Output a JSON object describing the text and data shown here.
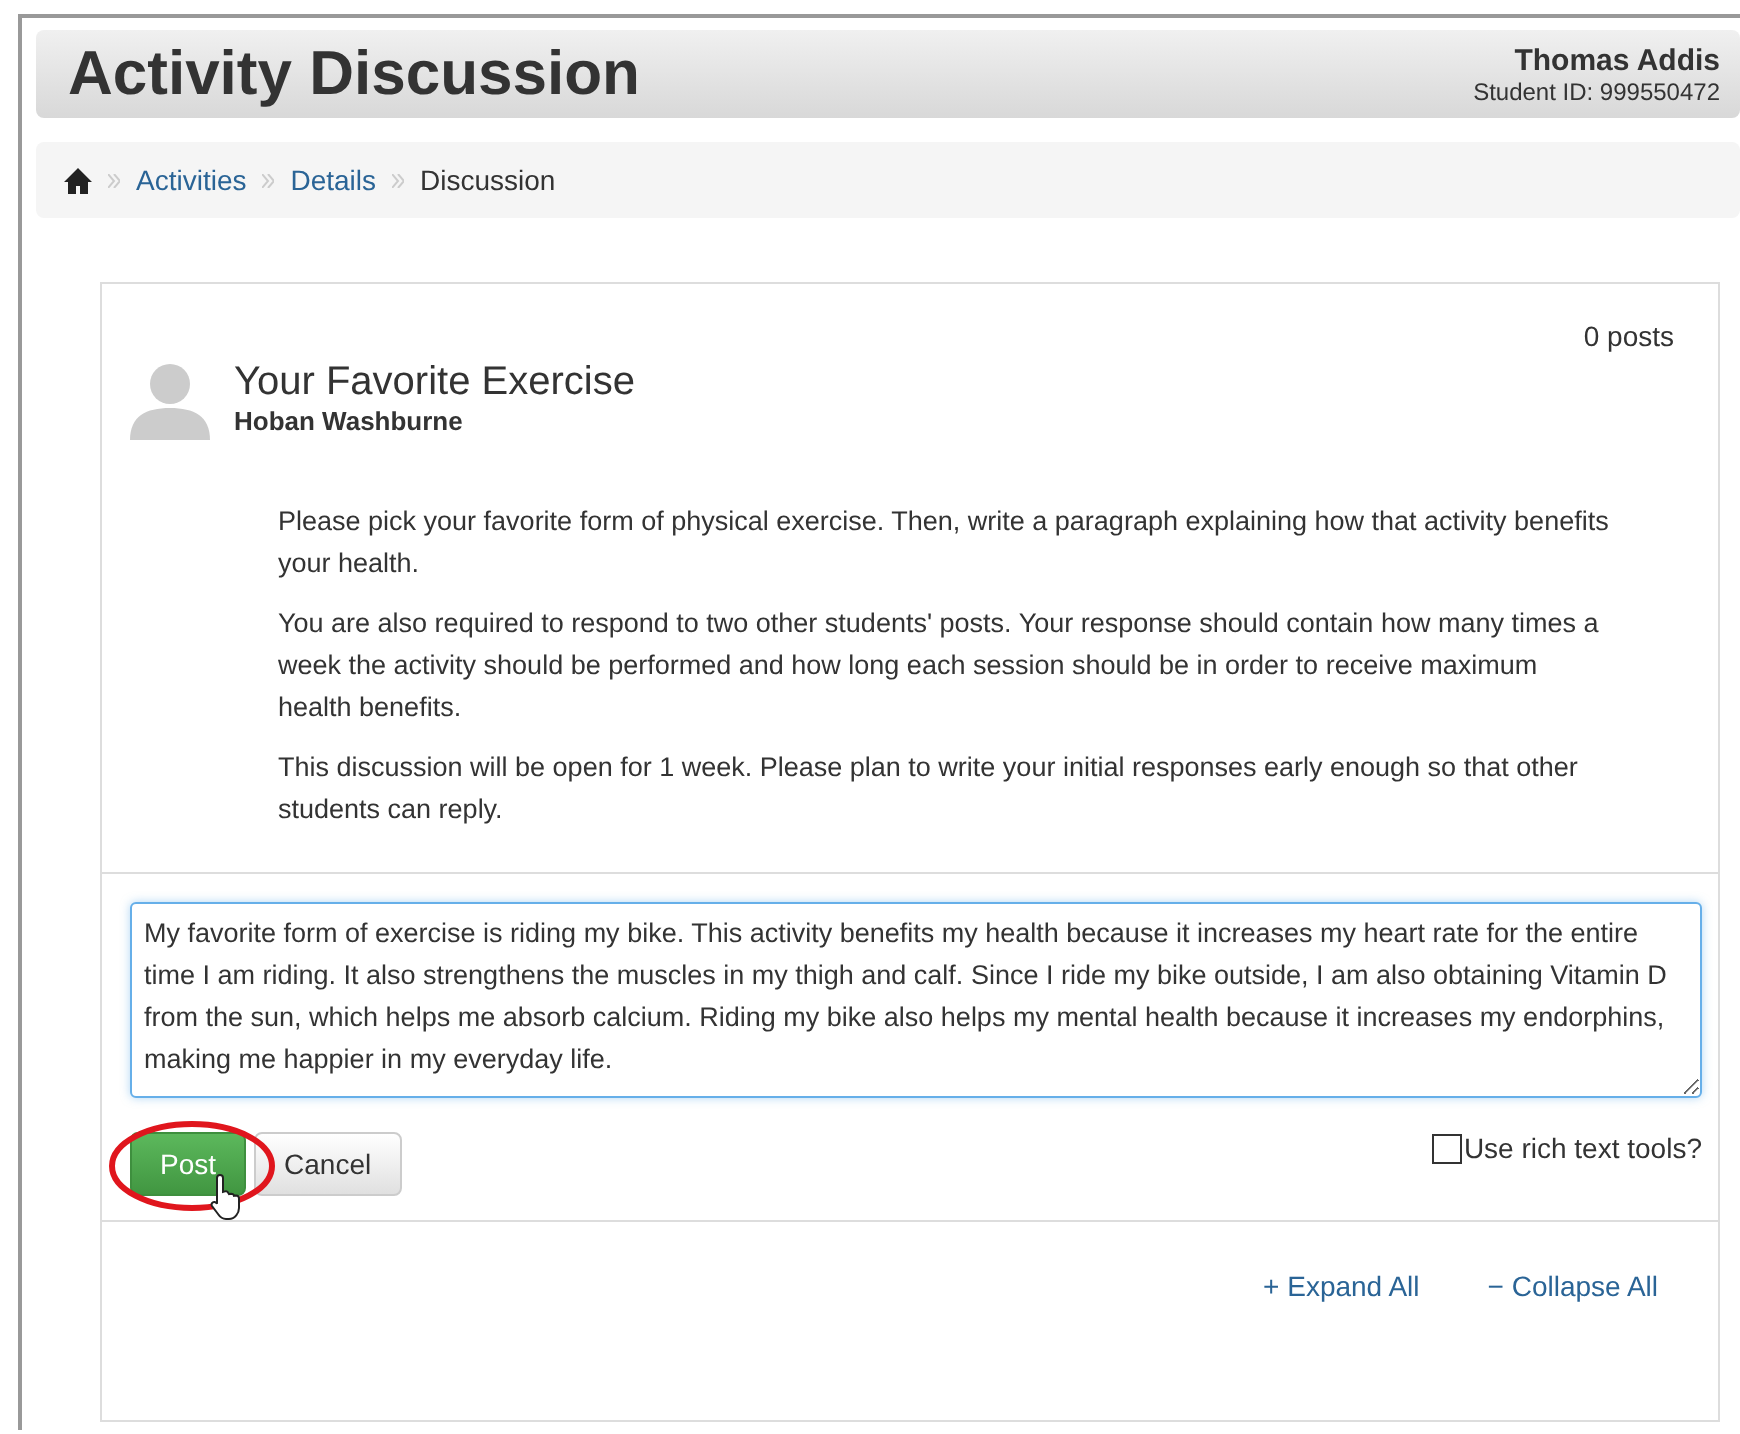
{
  "header": {
    "title": "Activity Discussion",
    "user_name": "Thomas Addis",
    "student_id": "Student ID: 999550472"
  },
  "breadcrumb": [
    {
      "label": "Activities",
      "kind": "link"
    },
    {
      "label": "Details",
      "kind": "link"
    },
    {
      "label": "Discussion",
      "kind": "current"
    }
  ],
  "topic": {
    "post_count": "0 posts",
    "title": "Your Favorite Exercise",
    "author": "Hoban Washburne",
    "paragraphs": [
      "Please pick your favorite form of physical exercise. Then, write a paragraph explaining how that activity benefits your health.",
      "You are also required to respond to two other students' posts. Your response should contain how many times a week the activity should be performed and how long each session should be in order to receive maximum health benefits.",
      "This discussion will be open for 1 week. Please plan to write your initial responses early enough so that other students can reply."
    ]
  },
  "reply": {
    "value": "My favorite form of exercise is riding my bike. This activity benefits my health because it increases my heart rate for the entire time I am riding. It also strengthens the muscles in my thigh and calf. Since I ride my bike outside, I am also obtaining Vitamin D from the sun, which helps me absorb calcium. Riding my bike also helps my mental health because it increases my endorphins, making me happier in my everyday life.",
    "buttons": [
      {
        "label": "Post",
        "kind": "primary"
      },
      {
        "label": "Cancel",
        "kind": "default"
      }
    ],
    "rich_text": {
      "label": "Use rich text tools?",
      "checked": false
    }
  },
  "footer_links": [
    "+ Expand All",
    "− Collapse All"
  ]
}
